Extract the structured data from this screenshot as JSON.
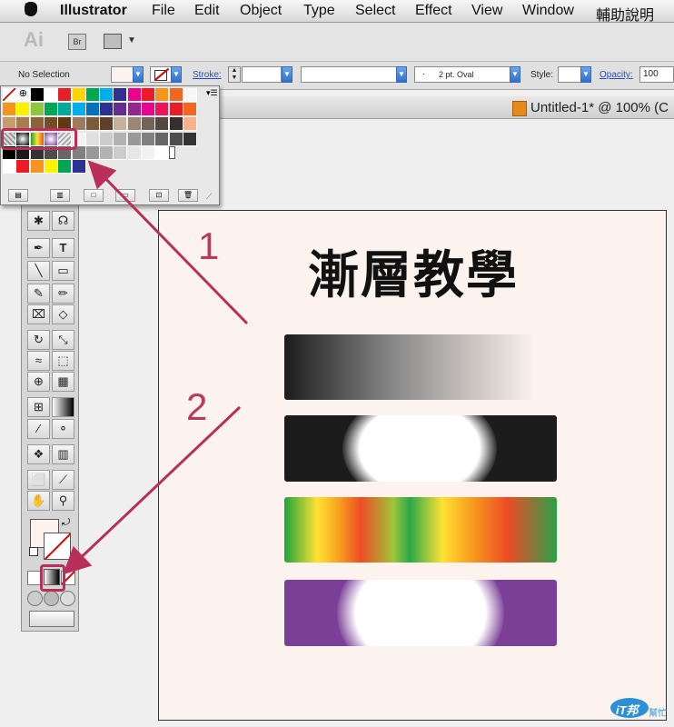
{
  "menu": {
    "apple": "",
    "app": "Illustrator",
    "items": [
      "File",
      "Edit",
      "Object",
      "Type",
      "Select",
      "Effect",
      "View",
      "Window",
      "輔助說明"
    ]
  },
  "appbar": {
    "ai_logo": "Ai",
    "br_label": "Br"
  },
  "control": {
    "selection": "No Selection",
    "stroke_label": "Stroke:",
    "brush_label": "2 pt. Oval",
    "style_label": "Style:",
    "opacity_label": "Opacity:",
    "opacity_value": "100"
  },
  "document": {
    "tab_title": "Untitled-1* @ 100% (C"
  },
  "artboard": {
    "heading": "漸層教學"
  },
  "annotations": {
    "step1": "1",
    "step2": "2"
  },
  "watermark": {
    "text1": "iT邦",
    "text2": "幫忙"
  },
  "colors": {
    "highlight": "#b8305a",
    "artboard": "#fdf3ee",
    "purple": "#7b3f98"
  }
}
